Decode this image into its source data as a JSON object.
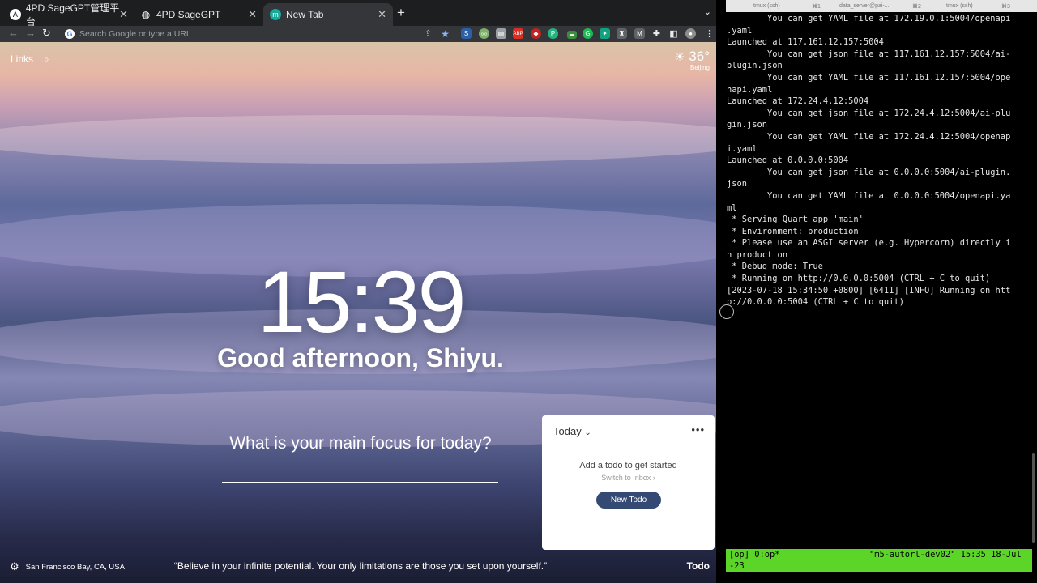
{
  "browser": {
    "tabs": [
      {
        "title": "4PD SageGPT管理平台",
        "favicon": "A"
      },
      {
        "title": "4PD SageGPT",
        "favicon": "globe"
      },
      {
        "title": "New Tab",
        "favicon": "m"
      }
    ],
    "omnibox_placeholder": "Search Google or type a URL",
    "extensions": [
      "share",
      "star",
      "S",
      "O",
      "doc",
      "ABP",
      "red",
      "P",
      "gr",
      "G",
      "bk",
      "M",
      "puzzle",
      "split",
      "profile",
      "menu"
    ]
  },
  "newtab": {
    "links_label": "Links",
    "weather_temp": "36°",
    "weather_city": "Beijing",
    "clock": "15:39",
    "greeting": "Good afternoon, Shiyu.",
    "focus_question": "What is your main focus for today?",
    "todo": {
      "header": "Today",
      "empty_message": "Add a todo to get started",
      "switch_link": "Switch to Inbox",
      "new_button": "New Todo"
    },
    "location": "San Francisco Bay, CA, USA",
    "quote": "“Believe in your infinite potential. Your only limitations are those you set upon yourself.”",
    "todo_link": "Todo"
  },
  "terminal": {
    "tabs": [
      "tmux (ssh)",
      "⌘1",
      "data_server@pai-...",
      "⌘2",
      "tmux (ssh)",
      "⌘3"
    ],
    "lines": [
      "        You can get YAML file at 172.19.0.1:5004/openapi",
      ".yaml",
      "Launched at 117.161.12.157:5004",
      "        You can get json file at 117.161.12.157:5004/ai-",
      "plugin.json",
      "        You can get YAML file at 117.161.12.157:5004/ope",
      "napi.yaml",
      "Launched at 172.24.4.12:5004",
      "        You can get json file at 172.24.4.12:5004/ai-plu",
      "gin.json",
      "        You can get YAML file at 172.24.4.12:5004/openap",
      "i.yaml",
      "Launched at 0.0.0.0:5004",
      "        You can get json file at 0.0.0.0:5004/ai-plugin.",
      "json",
      "        You can get YAML file at 0.0.0.0:5004/openapi.ya",
      "ml",
      " * Serving Quart app 'main'",
      " * Environment: production",
      " * Please use an ASGI server (e.g. Hypercorn) directly i",
      "n production",
      " * Debug mode: True",
      " * Running on http://0.0.0.0:5004 (CTRL + C to quit)",
      "[2023-07-18 15:34:50 +0800] [6411] [INFO] Running on htt",
      "p://0.0.0.0:5004 (CTRL + C to quit)"
    ],
    "status_left": "[op] 0:op*",
    "status_right": "\"m5-autorl-dev02\" 15:35 18-Jul",
    "status_line2": "-23"
  }
}
